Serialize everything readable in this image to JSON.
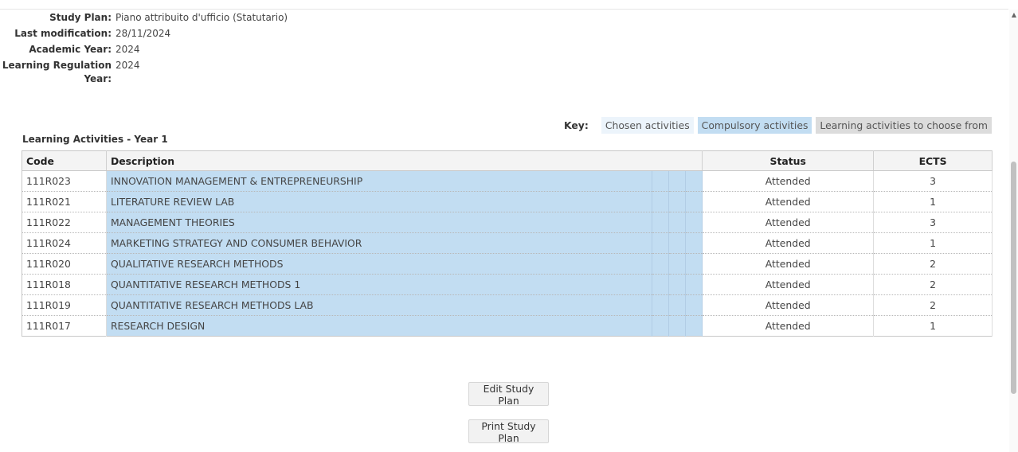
{
  "info": [
    {
      "label": "Study Plan:",
      "value": "Piano attribuito d'ufficio (Statutario)"
    },
    {
      "label": "Last modification:",
      "value": "28/11/2024"
    },
    {
      "label": "Academic Year:",
      "value": "2024"
    },
    {
      "label": "Learning Regulation Year:",
      "value": "2024"
    }
  ],
  "legend": {
    "key_label": "Key:",
    "chosen": "Chosen activities",
    "compulsory": "Compulsory activities",
    "to_choose": "Learning activities to choose from"
  },
  "section_title": "Learning Activities - Year 1",
  "table": {
    "headers": {
      "code": "Code",
      "description": "Description",
      "status": "Status",
      "ects": "ECTS"
    },
    "rows": [
      {
        "code": "111R023",
        "description": "INNOVATION MANAGEMENT & ENTREPRENEURSHIP",
        "status": "Attended",
        "ects": "3"
      },
      {
        "code": "111R021",
        "description": "LITERATURE REVIEW LAB",
        "status": "Attended",
        "ects": "1"
      },
      {
        "code": "111R022",
        "description": "MANAGEMENT THEORIES",
        "status": "Attended",
        "ects": "3"
      },
      {
        "code": "111R024",
        "description": "MARKETING STRATEGY AND CONSUMER BEHAVIOR",
        "status": "Attended",
        "ects": "1"
      },
      {
        "code": "111R020",
        "description": "QUALITATIVE RESEARCH METHODS",
        "status": "Attended",
        "ects": "2"
      },
      {
        "code": "111R018",
        "description": "QUANTITATIVE RESEARCH METHODS 1",
        "status": "Attended",
        "ects": "2"
      },
      {
        "code": "111R019",
        "description": "QUANTITATIVE RESEARCH METHODS LAB",
        "status": "Attended",
        "ects": "2"
      },
      {
        "code": "111R017",
        "description": "RESEARCH DESIGN",
        "status": "Attended",
        "ects": "1"
      }
    ]
  },
  "buttons": {
    "edit": "Edit Study Plan",
    "print": "Print Study Plan"
  },
  "colors": {
    "compulsory": "#c2ddf2",
    "chosen": "#ecf4fb",
    "to_choose": "#dcdcdc"
  }
}
